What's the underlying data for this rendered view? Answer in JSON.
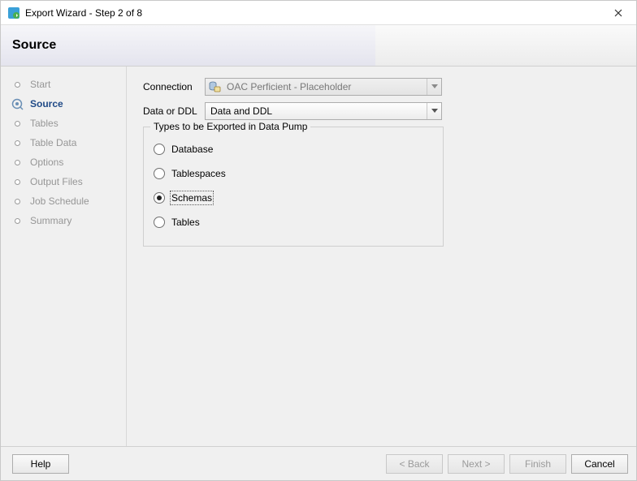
{
  "titlebar": {
    "title": "Export Wizard - Step 2 of 8"
  },
  "header": {
    "title": "Source"
  },
  "sidebar": {
    "steps": [
      {
        "label": "Start",
        "active": false
      },
      {
        "label": "Source",
        "active": true
      },
      {
        "label": "Tables",
        "active": false
      },
      {
        "label": "Table Data",
        "active": false
      },
      {
        "label": "Options",
        "active": false
      },
      {
        "label": "Output Files",
        "active": false
      },
      {
        "label": "Job Schedule",
        "active": false
      },
      {
        "label": "Summary",
        "active": false
      }
    ]
  },
  "form": {
    "connection_label": "Connection",
    "connection_value": "OAC Perficient - Placeholder",
    "data_or_ddl_label": "Data or DDL",
    "data_or_ddl_value": "Data and DDL",
    "types_legend": "Types to be Exported in Data Pump",
    "radios": {
      "database": "Database",
      "tablespaces": "Tablespaces",
      "schemas": "Schemas",
      "tables": "Tables",
      "selected": "schemas"
    }
  },
  "footer": {
    "help": "Help",
    "back": "< Back",
    "next": "Next >",
    "finish": "Finish",
    "cancel": "Cancel"
  }
}
